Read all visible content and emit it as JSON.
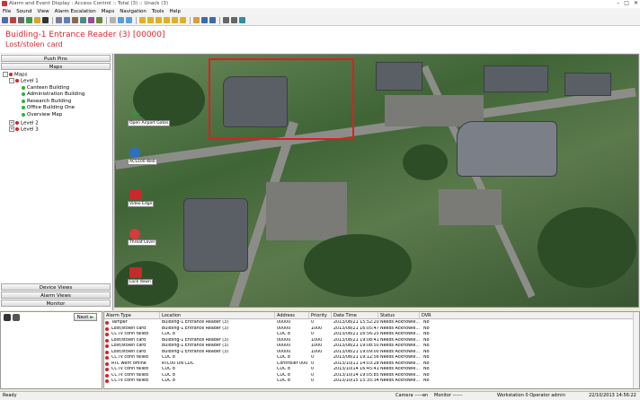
{
  "window": {
    "title": "Alarm and Event Display : Access Control :: Total (3) :: Unack (3)"
  },
  "menu": [
    "File",
    "Sound",
    "View",
    "Alarm Escalation",
    "Maps",
    "Navigation",
    "Tools",
    "Help"
  ],
  "alarm": {
    "line1": "Buidling-1 Entrance Reader (3) [00000]",
    "line2": "Lost/stolen card",
    "color": "#d9262e"
  },
  "left_panel": {
    "push_pins": "Push Pins",
    "maps": "Maps",
    "tree": [
      {
        "label": "Maps",
        "level": 0,
        "box": "-"
      },
      {
        "label": "Level 1",
        "level": 1,
        "box": "-"
      },
      {
        "label": "Canteen Building",
        "level": 2
      },
      {
        "label": "Administration Building",
        "level": 2
      },
      {
        "label": "Research Building",
        "level": 2
      },
      {
        "label": "Office Building One",
        "level": 2
      },
      {
        "label": "Overview Map",
        "level": 2
      },
      {
        "label": "Level 2",
        "level": 1,
        "box": "+"
      },
      {
        "label": "Level 3",
        "level": 1,
        "box": "+"
      }
    ],
    "device_views": "Device Views",
    "alarm_views": "Alarm Views",
    "monitor": "Monitor",
    "next_button": "Next"
  },
  "map": {
    "icons": [
      {
        "label": "Open Airport Gates",
        "icon": "airplane-icon",
        "color": "#2a9c3a"
      },
      {
        "label": "ACS100 Web",
        "icon": "globe-icon",
        "color": "#2f6fc0"
      },
      {
        "label": "Video Edge",
        "icon": "camera-icon",
        "color": "#c82a2a"
      },
      {
        "label": "Threat Level",
        "icon": "alert-icon",
        "color": "#d43b3b"
      },
      {
        "label": "Lock down",
        "icon": "lock-icon",
        "color": "#c82a2a"
      }
    ]
  },
  "table": {
    "columns": [
      "Alarm Type",
      "Location",
      "Address",
      "Priority",
      "Date Time",
      "Status",
      "DVR"
    ],
    "rows": [
      [
        "Tamper",
        "Buidling-1 Entrance Reader (3)",
        "00000",
        "0",
        "2013/08/21 15:52:20",
        "Needs Acknowle...",
        "No"
      ],
      [
        "Lost/stolen card",
        "Buidling-1 Entrance Reader (3)",
        "00000",
        "1000",
        "2013/08/21 16:05:47",
        "Needs Acknowle...",
        "No"
      ],
      [
        "CCTV conn failed",
        "CDC 8",
        "CDC 8",
        "0",
        "2013/08/21 16:56:25",
        "Needs Acknowle...",
        "No"
      ],
      [
        "Lost/stolen card",
        "Buidling-1 Entrance Reader (3)",
        "00000",
        "1000",
        "2013/08/21 19:08:41",
        "Needs Acknowle...",
        "No"
      ],
      [
        "Lost/stolen card",
        "Buidling-1 Entrance Reader (3)",
        "00000",
        "1000",
        "2013/08/21 19:08:50",
        "Needs Acknowle...",
        "No"
      ],
      [
        "Lost/stolen card",
        "Buidling-1 Entrance Reader (3)",
        "00000",
        "1000",
        "2013/08/21 19:09:00",
        "Needs Acknowle...",
        "No"
      ],
      [
        "CCTV conn failed",
        "CDC 8",
        "CDC 8",
        "0",
        "2013/08/21 19:12:56",
        "Needs Acknowle...",
        "No"
      ],
      [
        "RTC went offline",
        "RTC00 ON CDC",
        "Controller 000",
        "0",
        "2013/10/11 14:03:28",
        "Needs Acknowle...",
        "No"
      ],
      [
        "CCTV conn failed",
        "CDC 8",
        "CDC 8",
        "0",
        "2013/10/14 16:45:41",
        "Needs Acknowle...",
        "No"
      ],
      [
        "CCTV conn failed",
        "CDC 8",
        "CDC 8",
        "0",
        "2013/10/14 19:05:85",
        "Needs Acknowle...",
        "No"
      ],
      [
        "CCTV conn failed",
        "CDC 8",
        "CDC 8",
        "0",
        "2013/10/15 15:35:34",
        "Needs Acknowle...",
        "No"
      ]
    ]
  },
  "status": {
    "ready": "Ready",
    "camera": "Camera ------",
    "on": "on",
    "monitor": "Monitor ------",
    "workstation": "Workstation 0 Operator admin",
    "datetime": "22/10/2013 14:56:22"
  }
}
